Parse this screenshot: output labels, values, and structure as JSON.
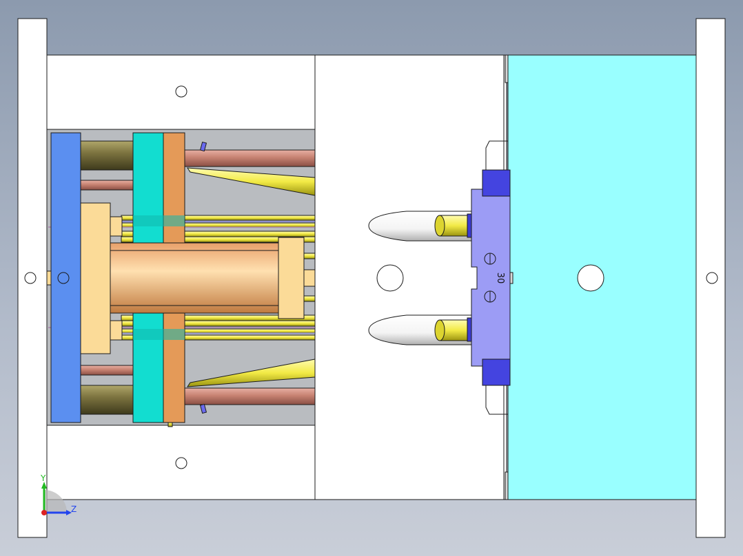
{
  "view": {
    "background_top": "#8c9aae",
    "background_bottom": "#c9ced8"
  },
  "colors": {
    "plate_white": "#ffffff",
    "cavity_cyan": "#99ffff",
    "clamp_blue": "#5b8ff0",
    "ejector_teal": "#12ddd0",
    "ejector_orange": "#e49a58",
    "spacer_tan": "#fbdb98",
    "rod_copper": "#c78272",
    "rod_olive": "#7d7440",
    "pin_yellow": "#f2ea45",
    "slider_lavender": "#9c9cf5",
    "slider_blue": "#4444e0"
  },
  "annotations": {
    "part_number": "30"
  },
  "axes": {
    "y_label": "Y",
    "z_label": "Z",
    "y_color": "#22bb22",
    "z_color": "#2244ee",
    "x_color": "#dd2222"
  },
  "icons": {
    "triad": "axis-triad-icon"
  }
}
